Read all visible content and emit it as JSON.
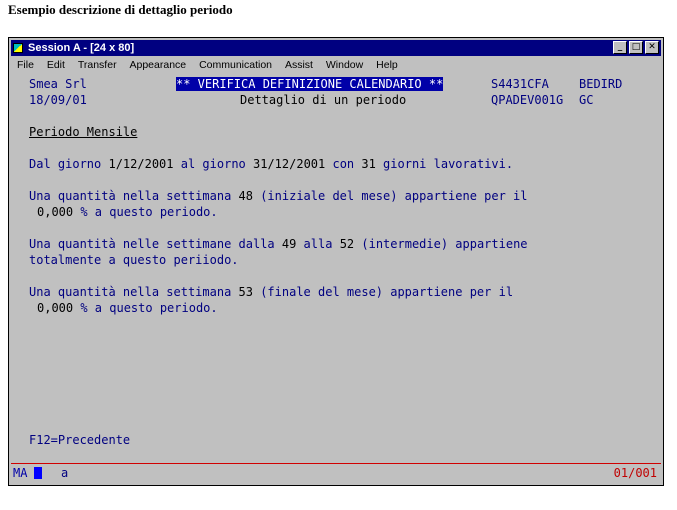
{
  "caption": "Esempio descrizione di dettaglio periodo",
  "window": {
    "title": "Session A - [24 x 80]",
    "controls": {
      "minimize": "_",
      "maximize": "□",
      "close": "✕"
    }
  },
  "menu": [
    "File",
    "Edit",
    "Transfer",
    "Appearance",
    "Communication",
    "Assist",
    "Window",
    "Help"
  ],
  "screen": {
    "company": "Smea Srl",
    "header_title": "** VERIFICA DEFINIZIONE CALENDARIO **",
    "code1": "S4431CFA",
    "user1": "BEDIRD",
    "date": "18/09/01",
    "subtitle": "Dettaglio di un periodo",
    "program": "QPADEV001G",
    "user2": "GC",
    "section_title": "Periodo Mensile",
    "line_dal_prefix": "Dal giorno ",
    "dal_from": "1/12/2001",
    "line_dal_mid": " al giorno ",
    "dal_to": "31/12/2001",
    "line_dal_con": " con ",
    "dal_days": "31",
    "line_dal_suffix": " giorni lavorativi.",
    "q1_prefix": "Una quantità nella settimana ",
    "q1_week": "48",
    "q1_suffix": " (iniziale del mese) appartiene per il",
    "q1_pct": "0,000",
    "q1_tail": " % a questo periodo.",
    "q2_prefix": "Una quantità nelle settimane dalla ",
    "q2_from": "49",
    "q2_mid": " alla ",
    "q2_to": "52",
    "q2_suffix": " (intermedie) appartiene",
    "q2_line2": "totalmente a questo periiodo.",
    "q3_prefix": "Una quantità nella settimana ",
    "q3_week": "53",
    "q3_suffix": " (finale del mese) appartiene per il",
    "q3_pct": "0,000",
    "q3_tail": " % a questo periodo.",
    "fkey": "F12=Precedente"
  },
  "status": {
    "indicator": "MA",
    "mode": "a",
    "position": "01/001"
  }
}
